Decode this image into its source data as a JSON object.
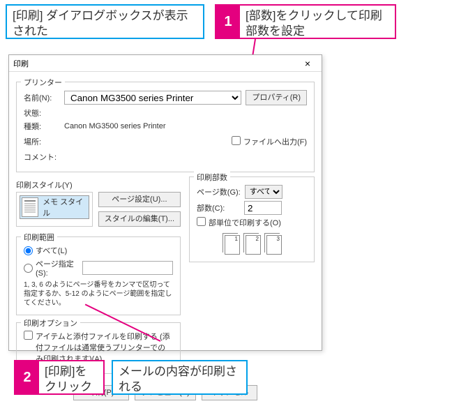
{
  "callouts": {
    "top_left": "[印刷] ダイアログボックスが表示された",
    "top_right_num": "1",
    "top_right_text": "[部数]をクリックして印刷部数を設定",
    "bottom_1_num": "2",
    "bottom_1_text": "[印刷]をクリック",
    "bottom_2": "メールの内容が印刷される"
  },
  "dialog": {
    "title": "印刷",
    "printer": {
      "group": "プリンター",
      "name_label": "名前(N):",
      "name_value": "Canon MG3500 series Printer",
      "props_btn": "プロパティ(R)",
      "status_label": "状態:",
      "status_value": "",
      "type_label": "種類:",
      "type_value": "Canon MG3500 series Printer",
      "where_label": "場所:",
      "where_value": "",
      "comment_label": "コメント:",
      "comment_value": "",
      "to_file": "ファイルへ出力(F)"
    },
    "style": {
      "label": "印刷スタイル(Y)",
      "selected": "メモ スタイル",
      "page_setup": "ページ設定(U)...",
      "edit": "スタイルの編集(T)..."
    },
    "copies": {
      "group": "印刷部数",
      "pages_label": "ページ数(G):",
      "pages_value": "すべて",
      "count_label": "部数(C):",
      "count_value": "2",
      "collate": "部単位で印刷する(O)",
      "pg1": "1",
      "pg2": "2",
      "pg3": "3"
    },
    "range": {
      "group": "印刷範囲",
      "all": "すべて(L)",
      "pages": "ページ指定(S):",
      "hint": "1, 3, 6 のようにページ番号をカンマで区切って指定するか、5-12 のようにページ範囲を指定してください。"
    },
    "options": {
      "group": "印刷オプション",
      "attach": "アイテムと添付ファイルを印刷する (添付ファイルは通常使うプリンターでのみ印刷されます)(A)"
    },
    "footer": {
      "print": "印刷(P)",
      "preview": "プレビュー(V)",
      "cancel": "キャンセル"
    }
  }
}
